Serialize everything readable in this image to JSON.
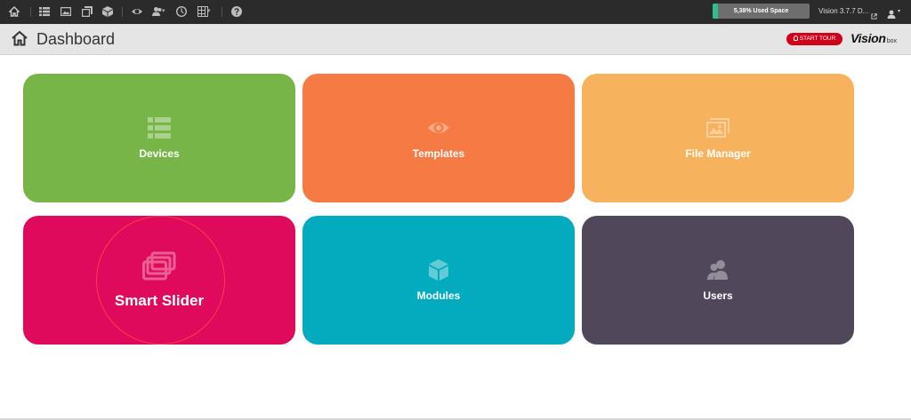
{
  "topbar": {
    "icons": [
      "home-icon",
      "devices-list-icon",
      "image-icon",
      "layers-icon",
      "cube-icon",
      "eye-icon",
      "users-icon",
      "clock-icon",
      "calendar-grid-icon",
      "help-icon"
    ],
    "storage": {
      "label": "5,38% Used Space",
      "used_fraction": 0.0538,
      "fill_color": "#2cc08e"
    },
    "version": "Vision 3.7.7 D..."
  },
  "header": {
    "title": "Dashboard",
    "tour_button": "START TOUR",
    "logo": {
      "main": "Vision",
      "sub": "box"
    }
  },
  "tiles": [
    {
      "label": "Devices",
      "icon": "list-icon",
      "color": "#77b548"
    },
    {
      "label": "Templates",
      "icon": "eye-icon",
      "color": "#f57a44"
    },
    {
      "label": "File Manager",
      "icon": "images-icon",
      "color": "#f7b25d"
    },
    {
      "label": "Smart Slider",
      "icon": "slides-icon",
      "color": "#e00a5c"
    },
    {
      "label": "Modules",
      "icon": "cube-icon",
      "color": "#03abbe"
    },
    {
      "label": "Users",
      "icon": "users-icon",
      "color": "#50475b"
    }
  ]
}
